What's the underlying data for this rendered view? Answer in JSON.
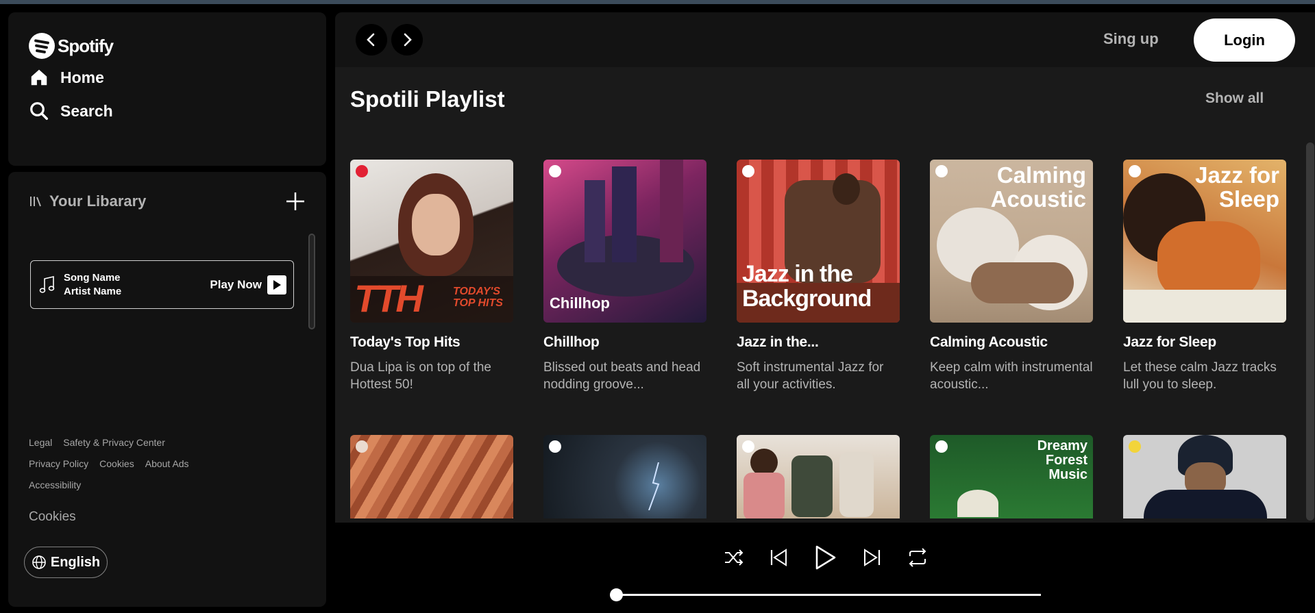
{
  "sidebar": {
    "brand": "Spotify",
    "nav": [
      {
        "label": "Home",
        "icon": "home-icon"
      },
      {
        "label": "Search",
        "icon": "search-icon"
      }
    ],
    "library": {
      "title": "Your Libarary",
      "now_playing": {
        "song": "Song Name",
        "artist": "Artist Name",
        "action": "Play Now"
      }
    },
    "footer": {
      "links_row1": [
        "Legal",
        "Safety & Privacy Center"
      ],
      "links_row2": [
        "Privacy Policy",
        "Cookies",
        "About Ads"
      ],
      "links_row3": [
        "Accessibility"
      ],
      "cookies": "Cookies",
      "language": "English"
    }
  },
  "header": {
    "signup": "Sing up",
    "login": "Login"
  },
  "main": {
    "section_title": "Spotili Playlist",
    "show_all": "Show all",
    "playlists": [
      {
        "title": "Today's Top Hits",
        "desc": "Dua Lipa is on top of the Hottest 50!",
        "cover_text": "TODAY'S TOP HITS",
        "cover_logo": "TTH",
        "accent": "#e24a2c"
      },
      {
        "title": "Chillhop",
        "desc": "Blissed out beats and head nodding groove...",
        "cover_text": "Chillhop",
        "accent": "#b0396a"
      },
      {
        "title": "Jazz in the...",
        "desc": "Soft instrumental Jazz for all your activities.",
        "cover_text": "Jazz in the Background",
        "accent": "#8a3024"
      },
      {
        "title": "Calming Acoustic",
        "desc": "Keep calm with instrumental acoustic...",
        "cover_text": "Calming Acoustic",
        "accent": "#c9b39a"
      },
      {
        "title": "Jazz for Sleep",
        "desc": "Let these calm Jazz tracks lull you to sleep.",
        "cover_text": "Jazz for Sleep",
        "accent": "#d9893e"
      }
    ],
    "row2_covers": [
      {
        "cover_text": "",
        "accent": "#b5603e"
      },
      {
        "cover_text": "",
        "accent": "#2a3440"
      },
      {
        "cover_text": "",
        "accent": "#c9b59c"
      },
      {
        "cover_text": "Dreamy Forest Music",
        "accent": "#1f6b2a"
      },
      {
        "cover_text": "",
        "accent": "#c8c8c8"
      }
    ]
  },
  "player": {
    "controls": [
      "shuffle-icon",
      "previous-icon",
      "play-icon",
      "next-icon",
      "repeat-icon"
    ],
    "progress": 0
  }
}
